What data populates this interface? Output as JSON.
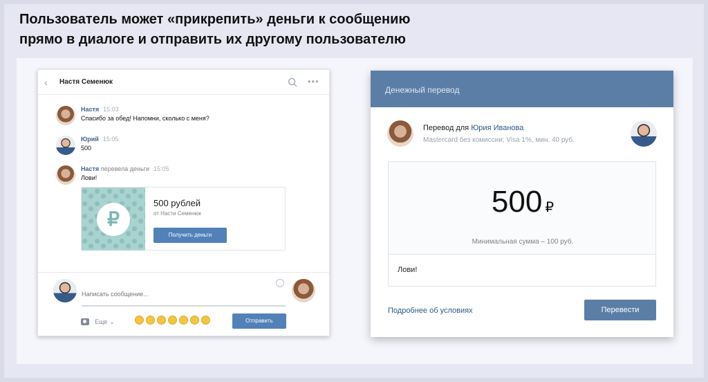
{
  "headline": {
    "line1": "Пользователь может «прикрепить» деньги к сообщению",
    "line2": "прямо в диалоге и отправить их другому пользователю"
  },
  "chat": {
    "title": "Настя Семенюк",
    "back_icon": "chevron-left-icon",
    "messages": [
      {
        "name": "Настя",
        "action": "",
        "time": "15:03",
        "text": "Спасибо за обед! Напомни, сколько с меня?"
      },
      {
        "name": "Юрий",
        "action": "",
        "time": "15:05",
        "text": "500"
      },
      {
        "name": "Настя",
        "action": "перевела деньги",
        "time": "15:05",
        "text": "Лови!"
      }
    ],
    "money_card": {
      "currency_symbol": "₽",
      "amount": "500 рублей",
      "from": "от Насти Семенюк",
      "button": "Получить деньги"
    },
    "composer": {
      "placeholder": "Написать сообщение...",
      "more": "Еще",
      "send": "Отправить"
    }
  },
  "dialog": {
    "title": "Денежный перевод",
    "recipient_prefix": "Перевод для",
    "recipient_name": "Юрия Иванова",
    "fee_info": "Mastercard без комиссии; Visa 1%, мин. 40 руб.",
    "amount": "500",
    "currency": "₽",
    "min_amount": "Минимальная сумма – 100 руб.",
    "comment": "Лови!",
    "terms_link": "Подробнее об условиях",
    "submit": "Перевести"
  },
  "colors": {
    "accent": "#5181b8",
    "dialog_header": "#5b7ea7",
    "link": "#2a5885"
  }
}
